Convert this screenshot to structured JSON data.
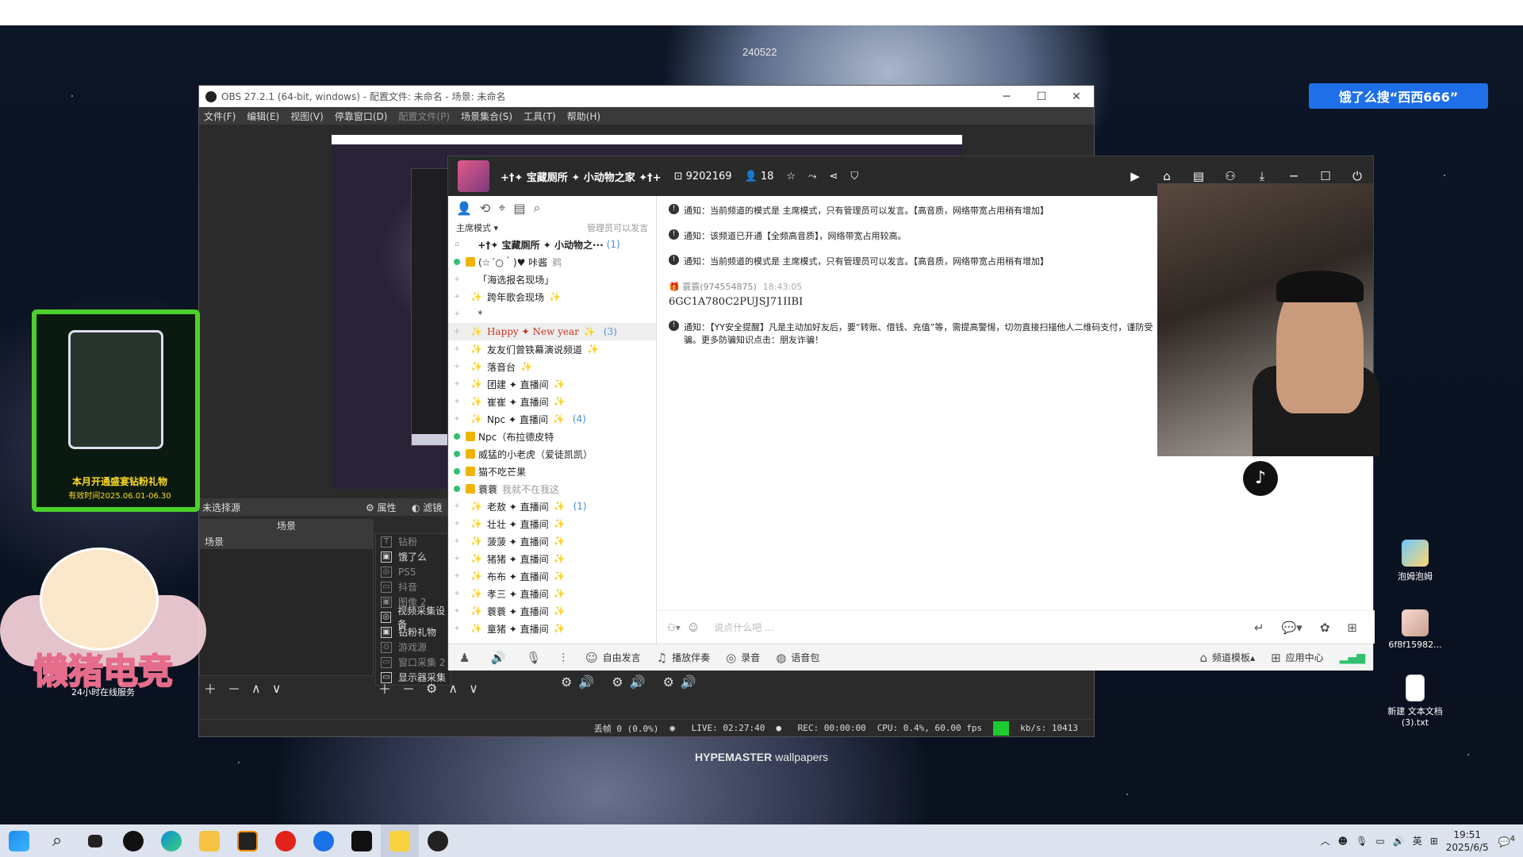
{
  "wallpaper": {
    "top_label": "240522",
    "brand_bold": "HYPEMASTER",
    "brand_rest": " wallpapers"
  },
  "search_banner": "饿了么搜“西西666”",
  "desktop_icons": [
    {
      "label": "泡姆泡姆"
    },
    {
      "label": "6f8f15982..."
    },
    {
      "label": "新建 文本文档 (3).txt"
    }
  ],
  "stickers": {
    "mug_line1": "本月开通盛宴钻粉礼物",
    "mug_line2": "有效时间2025.06.01-06.30",
    "bear_logo": "懒猪电竞",
    "bear_sub": "24小时在线服务"
  },
  "obs": {
    "title": "OBS 27.2.1 (64-bit, windows) - 配置文件: 未命名 - 场景: 未命名",
    "menu": [
      "文件(F)",
      "编辑(E)",
      "视图(V)",
      "停靠窗口(D)",
      "配置文件(P)",
      "场景集合(S)",
      "工具(T)",
      "帮助(H)"
    ],
    "no_source": "未选择源",
    "props": "属性",
    "filters": "滤镜",
    "scenes_header": "场景",
    "scene_item": "场景",
    "sources": [
      {
        "icon": "T",
        "label": "钻粉",
        "dim": true
      },
      {
        "icon": "▣",
        "label": "饿了么",
        "dim": false
      },
      {
        "icon": "◎",
        "label": "PS5",
        "dim": true
      },
      {
        "icon": "▭",
        "label": "抖音",
        "dim": true
      },
      {
        "icon": "▣",
        "label": "图像 2",
        "dim": true
      },
      {
        "icon": "◎",
        "label": "视频采集设备",
        "dim": false
      },
      {
        "icon": "▣",
        "label": "钻粉礼物",
        "dim": false
      },
      {
        "icon": "⊙",
        "label": "游戏源",
        "dim": true
      },
      {
        "icon": "▭",
        "label": "窗口采集 2",
        "dim": true
      },
      {
        "icon": "▭",
        "label": "显示器采集",
        "dim": false
      }
    ],
    "status": {
      "dropped": "丢帧 0 (0.0%)",
      "live": "LIVE: 02:27:40",
      "rec": "REC: 00:00:00",
      "cpu": "CPU: 0.4%, 60.00 fps",
      "kbs": "kb/s: 10413"
    }
  },
  "yy": {
    "channel_title": "+†✦ 宝藏厕所 ✦ 小动物之家 ✦†+",
    "channel_id": "9202169",
    "members": "18",
    "mode": "主席模式",
    "mode_note": "管理员可以发言",
    "channels": [
      {
        "name": "+†✦ 宝藏厕所 ✦ 小动物之···",
        "count": "(1)",
        "type": "root"
      },
      {
        "name": "(☆´○｀)♥ 咔酱",
        "extra": "鹈",
        "type": "user"
      },
      {
        "name": "「海选报名现场」",
        "type": "plain"
      },
      {
        "name": "跨年歌会现场",
        "type": "spark"
      },
      {
        "name": "*",
        "type": "plain"
      },
      {
        "name": "Happy ✦ New year",
        "count": "(3)",
        "type": "happy"
      },
      {
        "name": "友友们曾铁幕演说频道",
        "type": "spark"
      },
      {
        "name": "落音台",
        "type": "spark"
      },
      {
        "name": "团建 ✦ 直播间",
        "type": "spark"
      },
      {
        "name": "崔崔 ✦ 直播间",
        "type": "spark"
      },
      {
        "name": "Npc ✦ 直播间",
        "count": "(4)",
        "type": "spark"
      },
      {
        "name": "Npc（布拉德皮特",
        "type": "user"
      },
      {
        "name": "威猛的小老虎（爱徒凯凯）",
        "type": "user"
      },
      {
        "name": "猫不吃芒果",
        "type": "user"
      },
      {
        "name": "蓑蓑",
        "extra": "我就不在我这",
        "type": "user"
      },
      {
        "name": "老敖 ✦ 直播间",
        "count": "(1)",
        "type": "spark"
      },
      {
        "name": "壮壮 ✦ 直播间",
        "type": "spark"
      },
      {
        "name": "菠菠 ✦ 直播间",
        "type": "spark"
      },
      {
        "name": "猪猪 ✦ 直播间",
        "type": "spark"
      },
      {
        "name": "布布 ✦ 直播间",
        "type": "spark"
      },
      {
        "name": "孝三 ✦ 直播间",
        "type": "spark"
      },
      {
        "name": "蓑蓑 ✦ 直播间",
        "type": "spark"
      },
      {
        "name": "童猪 ✦ 直播间",
        "type": "spark"
      }
    ],
    "messages": [
      {
        "kind": "notice",
        "text": "通知：当前频道的模式是 主席模式，只有管理员可以发言。【高音质，网络带宽占用稍有增加】"
      },
      {
        "kind": "notice",
        "text": "通知：该频道已开通【全频高音质】，网络带宽占用较高。"
      },
      {
        "kind": "notice",
        "text": "通知：当前频道的模式是 主席模式，只有管理员可以发言。【高音质，网络带宽占用稍有增加】"
      },
      {
        "kind": "chat",
        "user": "蓑蓑(974554875)",
        "time": "18:43:05",
        "text": "6GC1A780C2PUJSJ71IIBI"
      },
      {
        "kind": "notice",
        "text": "通知：【YY安全提醒】凡是主动加好友后，要“转账、借钱、充值”等，需提高警惕，切勿直接扫描他人二维码支付，谨防受骗。更多防骗知识点击：朋友诈骗！"
      }
    ],
    "input_placeholder": "说点什么吧 ...",
    "bottom": {
      "free_speak": "自由发言",
      "accompany": "播放伴奏",
      "record": "录音",
      "voice_pack": "语音包",
      "template": "频道模板",
      "app_center": "应用中心"
    }
  },
  "taskbar": {
    "lang": "英",
    "time": "19:51",
    "date": "2025/6/5",
    "badge": "4"
  }
}
